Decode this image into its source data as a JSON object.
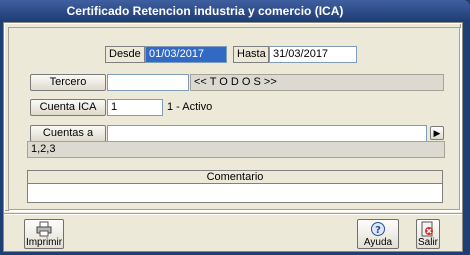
{
  "window": {
    "title": "Certificado Retencion industria y comercio (ICA)"
  },
  "dates": {
    "desde_label": "Desde",
    "desde_value": "01/03/2017",
    "hasta_label": "Hasta",
    "hasta_value": "31/03/2017"
  },
  "tercero": {
    "button_label": "Tercero",
    "value": "",
    "display": "<< T O D O S >>"
  },
  "cuenta_ica": {
    "button_label": "Cuenta ICA",
    "value": "1",
    "description": "1 - Activo"
  },
  "cuentas_excluir": {
    "button_label": "Cuentas a excluir",
    "value": "",
    "list": "1,2,3",
    "arrow_icon": "chevron-right-icon"
  },
  "comentario": {
    "header": "Comentario",
    "value": ""
  },
  "toolbar": {
    "imprimir_label": "Imprimir",
    "ayuda_label": "Ayuda",
    "salir_label": "Salir"
  }
}
